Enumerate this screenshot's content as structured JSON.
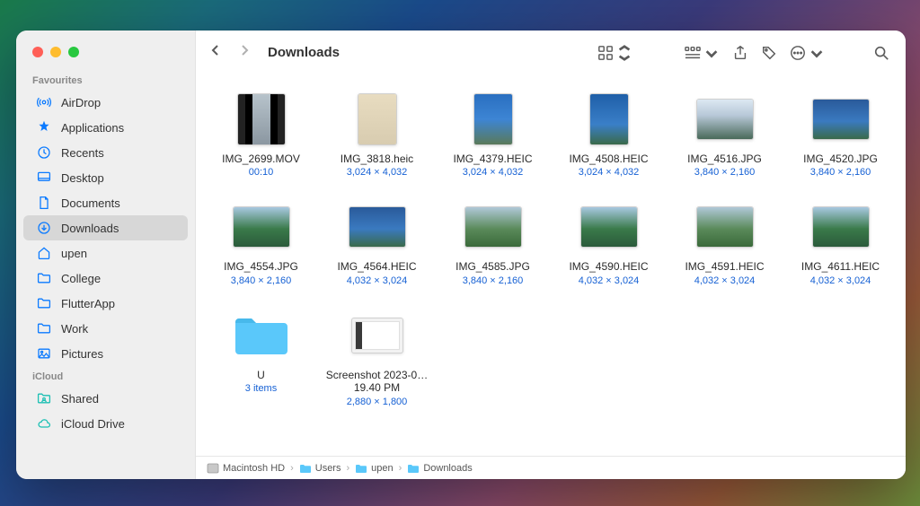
{
  "window": {
    "title": "Downloads"
  },
  "sidebar": {
    "sections": [
      {
        "label": "Favourites",
        "items": [
          {
            "id": "airdrop",
            "label": "AirDrop",
            "icon": "airdrop"
          },
          {
            "id": "applications",
            "label": "Applications",
            "icon": "apps"
          },
          {
            "id": "recents",
            "label": "Recents",
            "icon": "clock"
          },
          {
            "id": "desktop",
            "label": "Desktop",
            "icon": "desktop"
          },
          {
            "id": "documents",
            "label": "Documents",
            "icon": "doc"
          },
          {
            "id": "downloads",
            "label": "Downloads",
            "icon": "download",
            "active": true
          },
          {
            "id": "upen",
            "label": "upen",
            "icon": "home"
          },
          {
            "id": "college",
            "label": "College",
            "icon": "folder"
          },
          {
            "id": "flutterapp",
            "label": "FlutterApp",
            "icon": "folder"
          },
          {
            "id": "work",
            "label": "Work",
            "icon": "folder"
          },
          {
            "id": "pictures",
            "label": "Pictures",
            "icon": "pictures"
          }
        ]
      },
      {
        "label": "iCloud",
        "items": [
          {
            "id": "shared",
            "label": "Shared",
            "icon": "shared",
            "teal": true
          },
          {
            "id": "iclouddrive",
            "label": "iCloud Drive",
            "icon": "cloud",
            "teal": true
          }
        ]
      }
    ]
  },
  "files": [
    {
      "name": "IMG_2699.MOV",
      "meta": "00:10",
      "kind": "mov"
    },
    {
      "name": "IMG_3818.heic",
      "meta": "3,024 × 4,032",
      "kind": "portrait",
      "cls": "paper"
    },
    {
      "name": "IMG_4379.HEIC",
      "meta": "3,024 × 4,032",
      "kind": "portrait",
      "cls": "sky1"
    },
    {
      "name": "IMG_4508.HEIC",
      "meta": "3,024 × 4,032",
      "kind": "portrait",
      "cls": "sky2"
    },
    {
      "name": "IMG_4516.JPG",
      "meta": "3,840 × 2,160",
      "kind": "landscape",
      "cls": "sky3"
    },
    {
      "name": "IMG_4520.JPG",
      "meta": "3,840 × 2,160",
      "kind": "landscape",
      "cls": "sky4"
    },
    {
      "name": "IMG_4554.JPG",
      "meta": "3,840 × 2,160",
      "kind": "landscape",
      "cls": "grn1"
    },
    {
      "name": "IMG_4564.HEIC",
      "meta": "4,032 × 3,024",
      "kind": "landscape",
      "cls": "sky4"
    },
    {
      "name": "IMG_4585.JPG",
      "meta": "3,840 × 2,160",
      "kind": "landscape",
      "cls": "grn2"
    },
    {
      "name": "IMG_4590.HEIC",
      "meta": "4,032 × 3,024",
      "kind": "landscape",
      "cls": "grn1"
    },
    {
      "name": "IMG_4591.HEIC",
      "meta": "4,032 × 3,024",
      "kind": "landscape",
      "cls": "grn2"
    },
    {
      "name": "IMG_4611.HEIC",
      "meta": "4,032 × 3,024",
      "kind": "landscape",
      "cls": "grn1"
    },
    {
      "name": "U",
      "meta": "3 items",
      "kind": "folder"
    },
    {
      "name": "Screenshot 2023-0…19.40 PM",
      "meta": "2,880 × 1,800",
      "kind": "screenshot"
    }
  ],
  "path": [
    {
      "label": "Macintosh HD",
      "icon": "disk"
    },
    {
      "label": "Users",
      "icon": "bfolder"
    },
    {
      "label": "upen",
      "icon": "bfolder"
    },
    {
      "label": "Downloads",
      "icon": "bfolder"
    }
  ]
}
